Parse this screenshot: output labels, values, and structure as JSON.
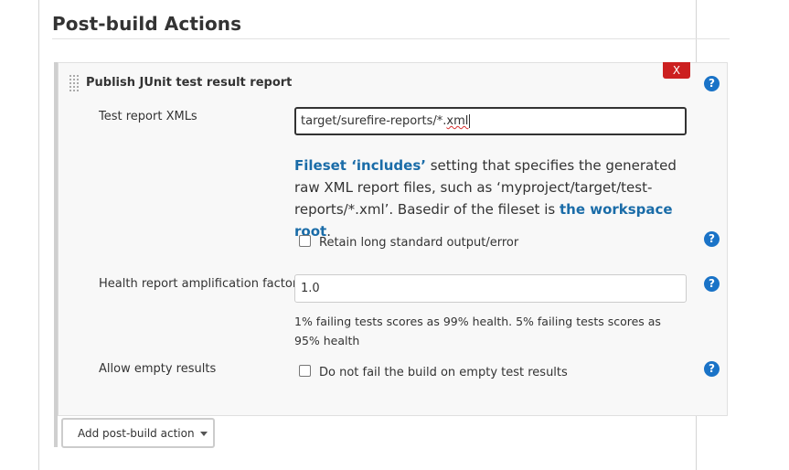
{
  "section": {
    "title": "Post-build Actions"
  },
  "step": {
    "title": "Publish JUnit test result report",
    "delete_label": "X",
    "help_glyph": "?"
  },
  "test_reports": {
    "label": "Test report XMLs",
    "value_plain": "target/surefire-reports/*.",
    "value_misspelled": "xml",
    "desc_link1": "Fileset ‘includes’",
    "desc_text1": " setting that specifies the generated raw XML report files, such as ‘myproject/target/test-reports/*.xml’. Basedir of the fileset is ",
    "desc_link2": "the workspace root",
    "desc_text2": "."
  },
  "retain": {
    "label": "Retain long standard output/error",
    "checked": false
  },
  "health": {
    "label": "Health report amplification factor",
    "value": "1.0",
    "help_text": "1% failing tests scores as 99% health. 5% failing tests scores as 95% health"
  },
  "empty_results": {
    "label": "Allow empty results",
    "checkbox_label": "Do not fail the build on empty test results",
    "checked": false
  },
  "add_action": {
    "label": "Add post-build action"
  },
  "colors": {
    "link": "#1a6ca8",
    "help_icon": "#1a73c7",
    "delete": "#cc2020"
  },
  "icons": {
    "help": "help-icon",
    "drag": "drag-handle-icon",
    "dropdown": "chevron-down-icon"
  }
}
